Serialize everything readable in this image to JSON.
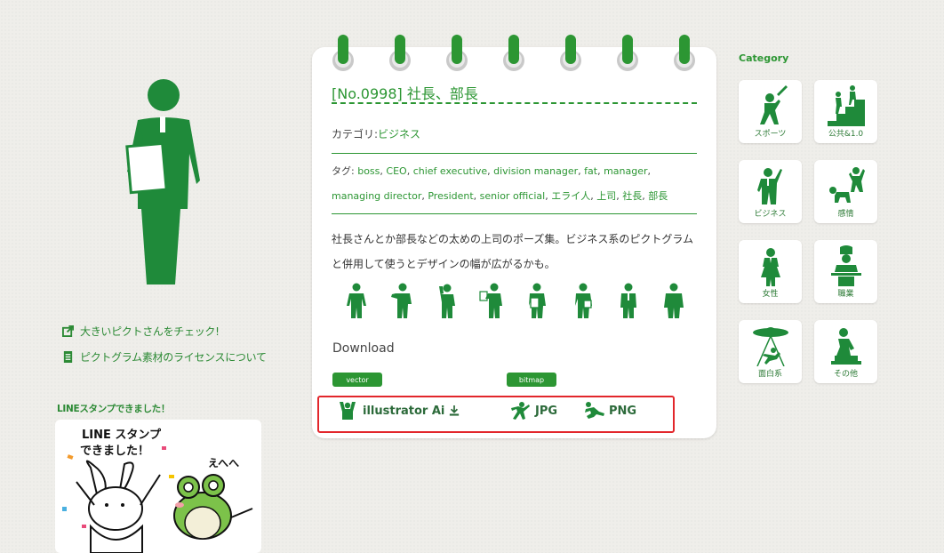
{
  "left": {
    "links": [
      {
        "label": "大きいピクトさんをチェック!",
        "icon": "external-link-icon"
      },
      {
        "label": "ピクトグラム素材のライセンスについて",
        "icon": "document-icon"
      }
    ],
    "line_heading": "LINEスタンプできました！",
    "line_banner": {
      "line1": "LINE スタンプ",
      "line2": "できました！",
      "line3": "えへへ"
    }
  },
  "post": {
    "title": "[No.0998] 社長、部長",
    "category_label": "カテゴリ:",
    "category_value": "ビジネス",
    "tags_label": "タグ:",
    "tags": [
      "boss",
      "CEO",
      "chief executive",
      "division manager",
      "fat",
      "manager",
      "managing director",
      "President",
      "senior official",
      "エライ人",
      "上司",
      "社長",
      "部長"
    ],
    "description": "社長さんとか部長などの太めの上司のポーズ集。ビジネス系のピクトグラムと併用して使うとデザインの幅が広がるかも。",
    "download_heading": "Download",
    "vector_label": "vector",
    "bitmap_label": "bitmap",
    "downloads": [
      {
        "label": "illustrator  Ai",
        "icon": "cheering-figure-icon",
        "extra_icon": "download-icon"
      },
      {
        "label": "JPG",
        "icon": "running-figure-icon"
      },
      {
        "label": "PNG",
        "icon": "sliding-figure-icon"
      }
    ]
  },
  "category": {
    "heading": "Category",
    "items": [
      {
        "label": "スポーツ",
        "icon": "baseball-batter-icon"
      },
      {
        "label": "公共&1.0",
        "icon": "stairs-people-icon"
      },
      {
        "label": "ビジネス",
        "icon": "presenter-icon"
      },
      {
        "label": "感情",
        "icon": "emotions-icon"
      },
      {
        "label": "女性",
        "icon": "woman-icon"
      },
      {
        "label": "職業",
        "icon": "chef-icon"
      },
      {
        "label": "面白系",
        "icon": "ufo-abduction-icon"
      },
      {
        "label": "その他",
        "icon": "other-figure-icon"
      }
    ]
  },
  "colors": {
    "accent": "#2c9633",
    "highlight_border": "#e2262b",
    "background": "#efeeea"
  }
}
